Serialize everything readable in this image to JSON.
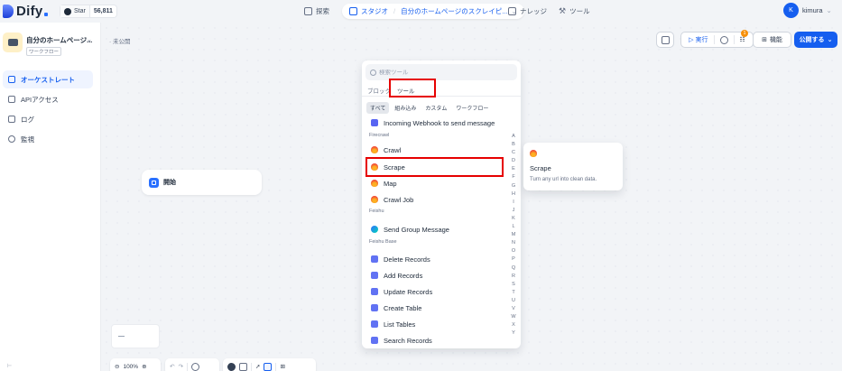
{
  "topbar": {
    "logo": "Dify",
    "github_label": "Star",
    "github_count": "56,811",
    "nav_explore": "探索",
    "nav_studio": "スタジオ",
    "nav_app": "自分のホームページのスクレイピ...",
    "nav_knowledge": "ナレッジ",
    "nav_tools": "ツール",
    "user_initial": "K",
    "user_name": "kimura"
  },
  "sidebar": {
    "app_name": "自分のホームページ...",
    "app_type": "ワークフロー",
    "items": [
      {
        "label": "オーケストレート",
        "icon": "layout-icon",
        "active": true
      },
      {
        "label": "APIアクセス",
        "icon": "api-icon",
        "active": false
      },
      {
        "label": "ログ",
        "icon": "log-icon",
        "active": false
      },
      {
        "label": "監視",
        "icon": "monitor-icon",
        "active": false
      }
    ]
  },
  "canvas": {
    "status": "未公開",
    "run_label": "実行",
    "checklist_badge": "1",
    "features_label": "機能",
    "publish_label": "公開する",
    "start_node": "開始",
    "zoom": "100%"
  },
  "picker": {
    "search_placeholder": "検索ツール",
    "tabs": [
      "ブロック",
      "ツール"
    ],
    "subtabs": [
      "すべて",
      "組み込み",
      "カスタム",
      "ワークフロー"
    ],
    "groups": {
      "firecrawl": "Firecrawl",
      "feishu": "Feishu",
      "feishu_base": "Feishu Base"
    },
    "items": {
      "webhook": "Incoming Webhook to send message",
      "crawl": "Crawl",
      "scrape": "Scrape",
      "map": "Map",
      "crawl_job": "Crawl Job",
      "send_group": "Send Group Message",
      "delete_records": "Delete Records",
      "add_records": "Add Records",
      "update_records": "Update Records",
      "create_table": "Create Table",
      "list_tables": "List Tables",
      "search_records": "Search Records"
    },
    "alphabet": "ABCDEFGHIJKLMNOPQRSTUVWXY"
  },
  "tooltip": {
    "title": "Scrape",
    "description": "Turn any url into clean data."
  },
  "colors": {
    "accent": "#155eef",
    "highlight": "#e60000"
  }
}
